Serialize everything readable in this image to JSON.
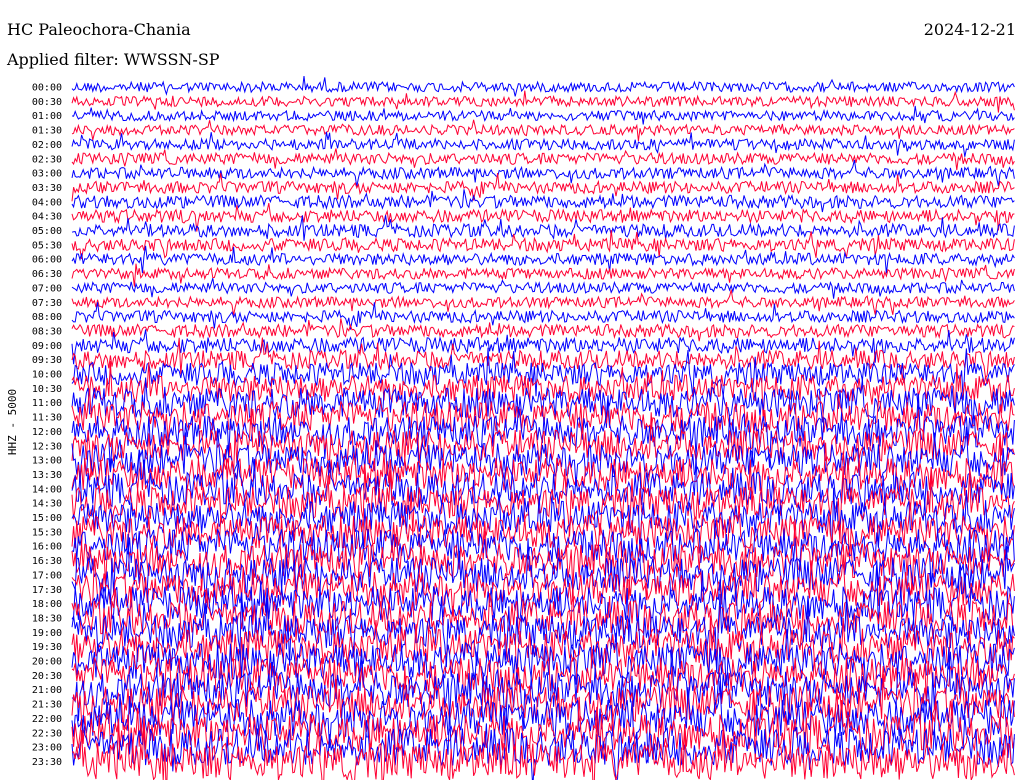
{
  "header": {
    "station": "HC Paleochora-Chania",
    "date": "2024-12-21",
    "filter_prefix": "Applied filter: ",
    "filter": "WWSSN-SP"
  },
  "chart_data": {
    "type": "line",
    "title": "HC Paleochora-Chania",
    "ylabel": "HHZ - 5000",
    "xlabel": "",
    "row_labels": [
      "00:00",
      "00:30",
      "01:00",
      "01:30",
      "02:00",
      "02:30",
      "03:00",
      "03:30",
      "04:00",
      "04:30",
      "05:00",
      "05:30",
      "06:00",
      "06:30",
      "07:00",
      "07:30",
      "08:00",
      "08:30",
      "09:00",
      "09:30",
      "10:00",
      "10:30",
      "11:00",
      "11:30",
      "12:00",
      "12:30",
      "13:00",
      "13:30",
      "14:00",
      "14:30",
      "15:00",
      "15:30",
      "16:00",
      "16:30",
      "17:00",
      "17:30",
      "18:00",
      "18:30",
      "19:00",
      "19:30",
      "20:00",
      "20:30",
      "21:00",
      "21:30",
      "22:00",
      "22:30",
      "23:00",
      "23:30"
    ],
    "series_colors": [
      "#0000ff",
      "#ff0033"
    ],
    "row_amplitude": [
      0.35,
      0.35,
      0.35,
      0.35,
      0.38,
      0.4,
      0.4,
      0.42,
      0.45,
      0.45,
      0.45,
      0.45,
      0.42,
      0.38,
      0.38,
      0.38,
      0.42,
      0.45,
      0.55,
      0.65,
      0.8,
      0.95,
      1.05,
      1.1,
      1.1,
      1.1,
      1.15,
      1.15,
      1.15,
      1.15,
      1.15,
      1.15,
      1.2,
      1.2,
      1.2,
      1.2,
      1.2,
      1.2,
      1.2,
      1.2,
      1.25,
      1.25,
      1.25,
      1.25,
      1.3,
      1.3,
      1.3,
      1.3
    ]
  }
}
